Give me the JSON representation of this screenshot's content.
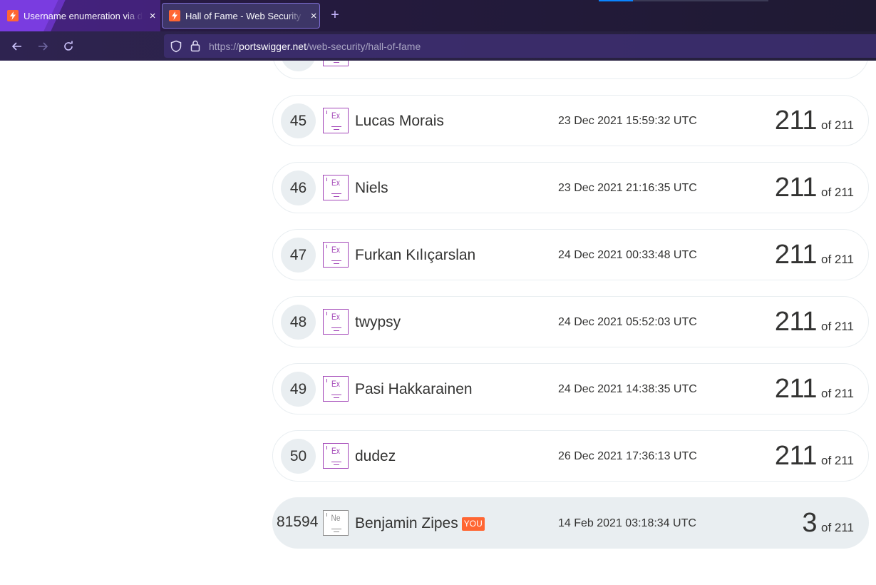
{
  "browser": {
    "tabs": [
      {
        "title": "Username enumeration via different responses",
        "active": false
      },
      {
        "title": "Hall of Fame - Web Security Academy",
        "active": true
      }
    ],
    "new_tab_symbol": "+",
    "close_symbol": "×",
    "url": {
      "scheme": "https://",
      "host": "portswigger.net",
      "path": "/web-security/hall-of-fame"
    },
    "icons": {
      "back": "back-arrow-icon",
      "forward": "forward-arrow-icon",
      "reload": "reload-icon",
      "shield": "tracking-protection-shield-icon",
      "lock": "lock-icon",
      "favicon": "portswigger-lightning-icon"
    }
  },
  "hall_of_fame": {
    "entries": [
      {
        "rank": "45",
        "badge": "Ex",
        "name": "Lucas Morais",
        "date": "23 Dec 2021 15:59:32 UTC",
        "score": "211",
        "total": "of 211"
      },
      {
        "rank": "46",
        "badge": "Ex",
        "name": "Niels",
        "date": "23 Dec 2021 21:16:35 UTC",
        "score": "211",
        "total": "of 211"
      },
      {
        "rank": "47",
        "badge": "Ex",
        "name": "Furkan Kılıçarslan",
        "date": "24 Dec 2021 00:33:48 UTC",
        "score": "211",
        "total": "of 211"
      },
      {
        "rank": "48",
        "badge": "Ex",
        "name": "twypsy",
        "date": "24 Dec 2021 05:52:03 UTC",
        "score": "211",
        "total": "of 211"
      },
      {
        "rank": "49",
        "badge": "Ex",
        "name": "Pasi Hakkarainen",
        "date": "24 Dec 2021 14:38:35 UTC",
        "score": "211",
        "total": "of 211"
      },
      {
        "rank": "50",
        "badge": "Ex",
        "name": "dudez",
        "date": "26 Dec 2021 17:36:13 UTC",
        "score": "211",
        "total": "of 211"
      }
    ],
    "current_user": {
      "rank": "81594",
      "badge": "Ne",
      "name": "Benjamin Zipes",
      "tag": "YOU",
      "date": "14 Feb 2021 03:18:34 UTC",
      "score": "3",
      "total": "of 211"
    }
  },
  "colors": {
    "accent_orange": "#ff6633",
    "expert_badge": "#a347b8",
    "row_bg": "#e9eef1",
    "text": "#333332"
  }
}
